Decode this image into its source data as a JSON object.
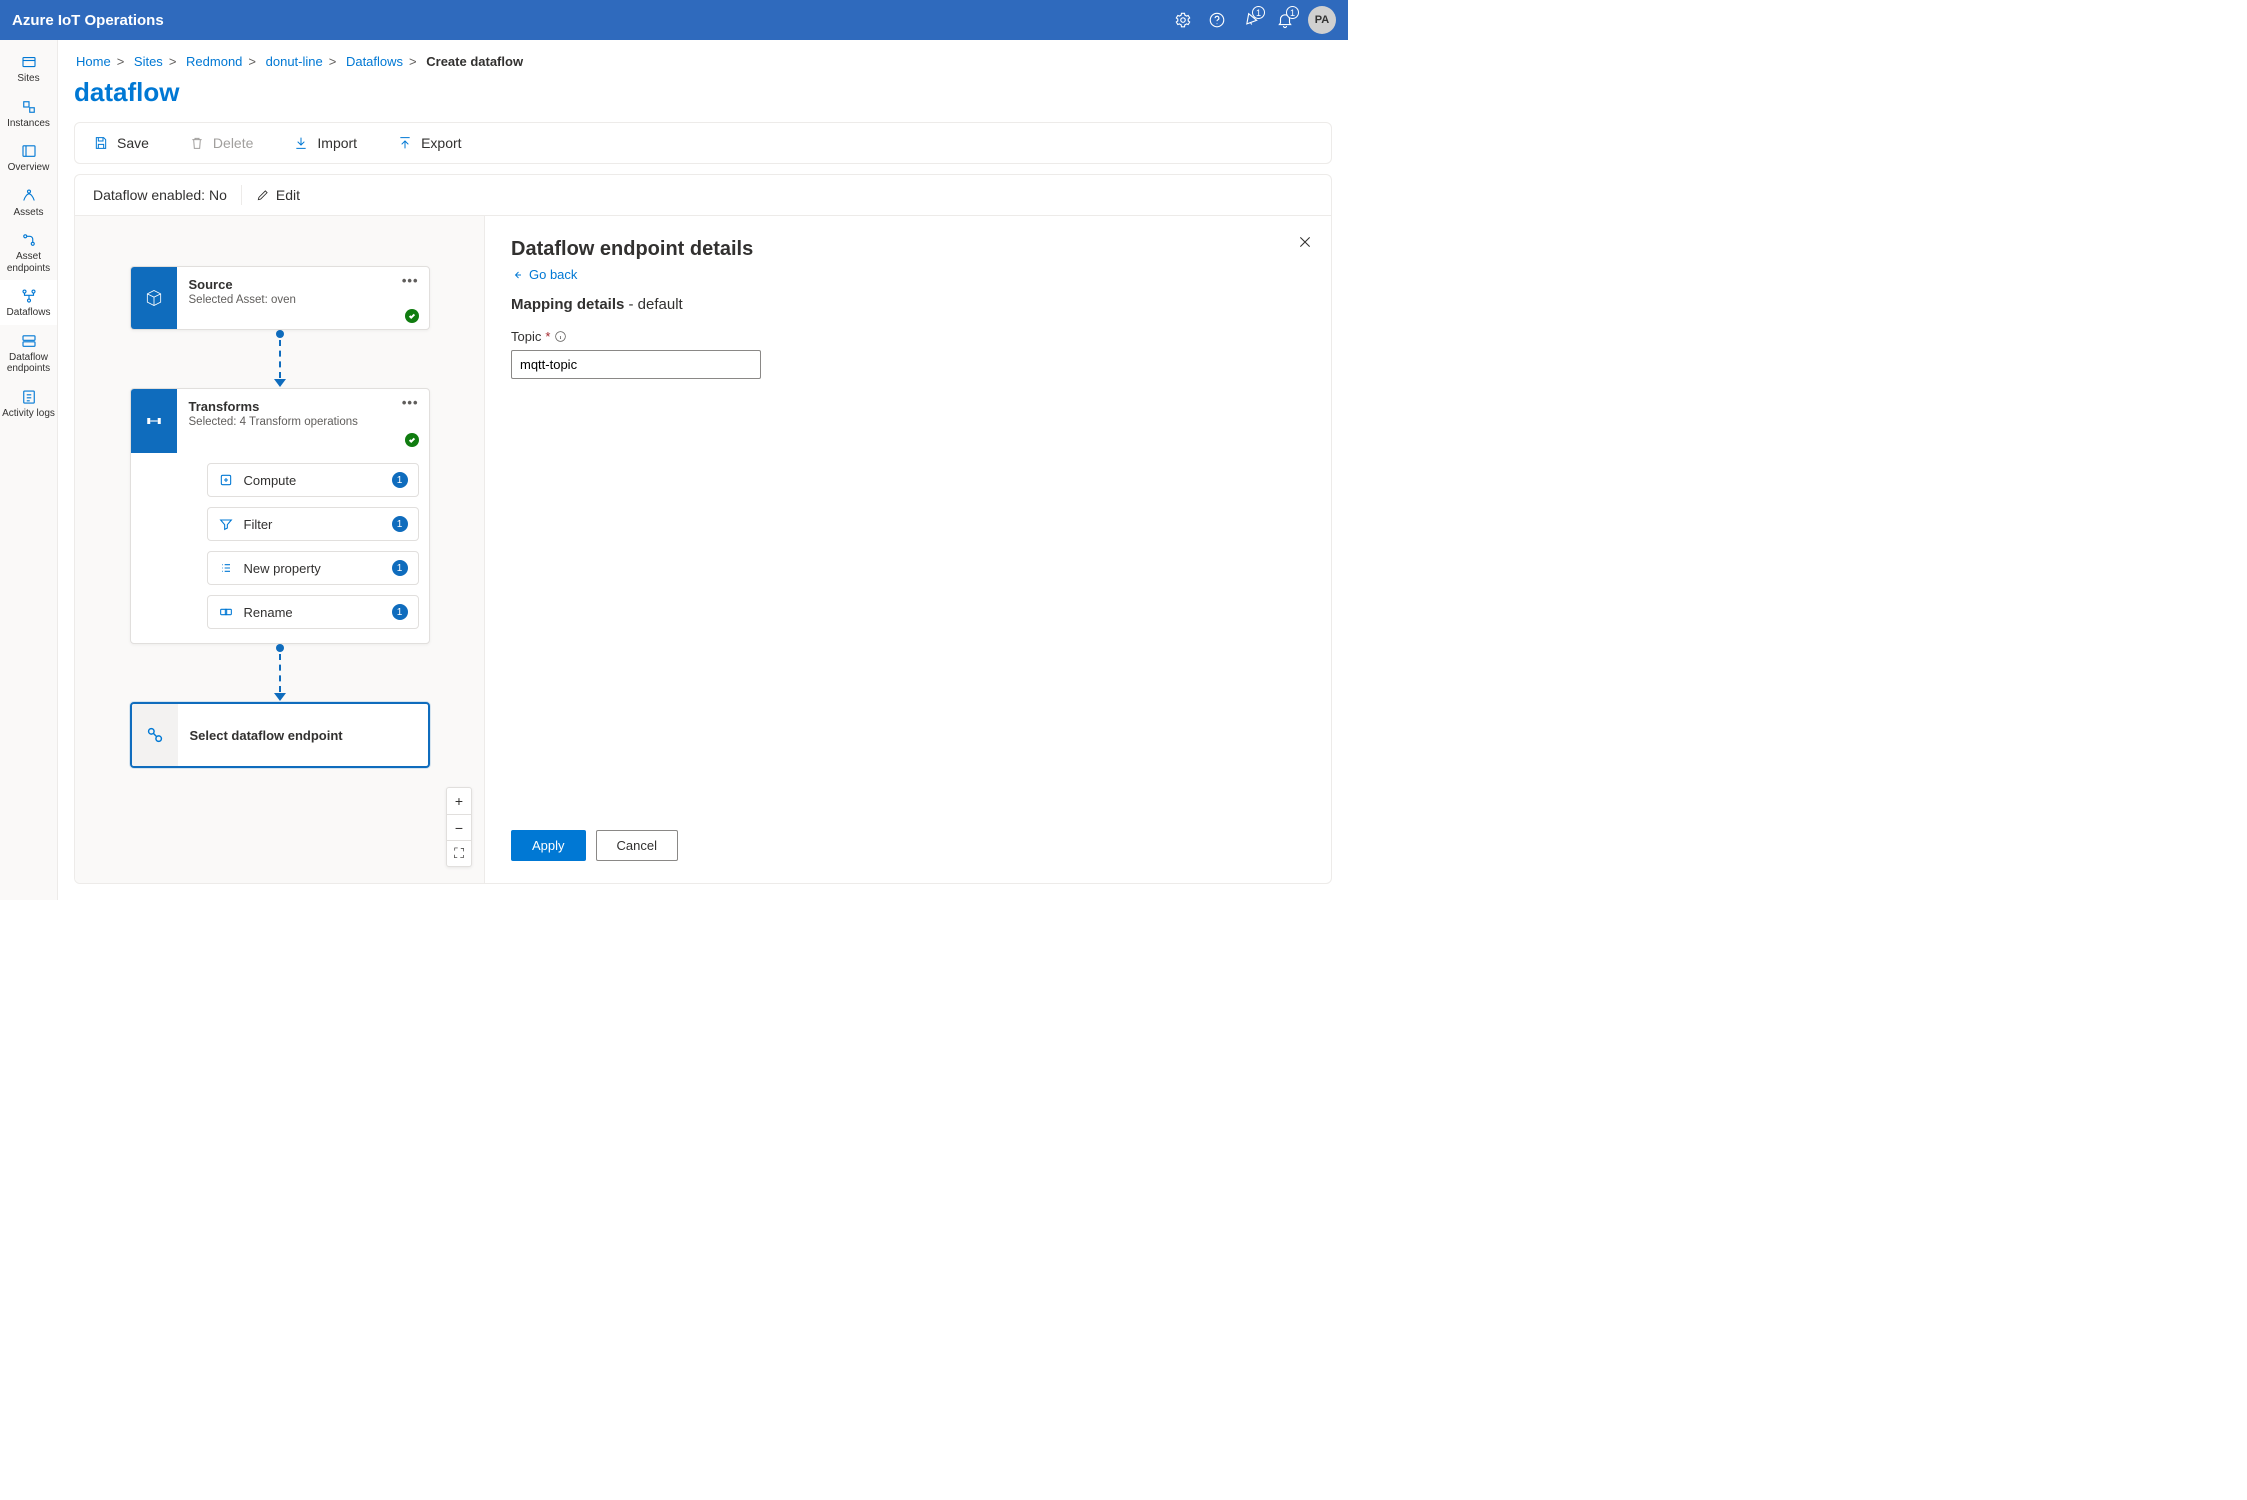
{
  "header": {
    "title": "Azure IoT Operations",
    "badge1": "1",
    "badge2": "1",
    "avatar": "PA"
  },
  "sidebar": {
    "items": [
      {
        "label": "Sites"
      },
      {
        "label": "Instances"
      },
      {
        "label": "Overview"
      },
      {
        "label": "Assets"
      },
      {
        "label": "Asset endpoints"
      },
      {
        "label": "Dataflows"
      },
      {
        "label": "Dataflow endpoints"
      },
      {
        "label": "Activity logs"
      }
    ]
  },
  "breadcrumb": {
    "home": "Home",
    "sites": "Sites",
    "redmond": "Redmond",
    "donut": "donut-line",
    "dataflows": "Dataflows",
    "current": "Create dataflow"
  },
  "page": {
    "title": "dataflow"
  },
  "toolbar": {
    "save": "Save",
    "delete": "Delete",
    "import": "Import",
    "export": "Export"
  },
  "status": {
    "enabledLabel": "Dataflow enabled: No",
    "edit": "Edit"
  },
  "canvas": {
    "source": {
      "title": "Source",
      "sub": "Selected Asset: oven"
    },
    "transforms": {
      "title": "Transforms",
      "sub": "Selected: 4 Transform operations",
      "ops": [
        {
          "label": "Compute",
          "count": "1"
        },
        {
          "label": "Filter",
          "count": "1"
        },
        {
          "label": "New property",
          "count": "1"
        },
        {
          "label": "Rename",
          "count": "1"
        }
      ]
    },
    "endpoint": {
      "label": "Select dataflow endpoint"
    }
  },
  "details": {
    "title": "Dataflow endpoint details",
    "goBack": "Go back",
    "mappingStrong": "Mapping details",
    "mappingSuffix": " - default",
    "topicLabel": "Topic",
    "topicValue": "mqtt-topic",
    "apply": "Apply",
    "cancel": "Cancel"
  }
}
